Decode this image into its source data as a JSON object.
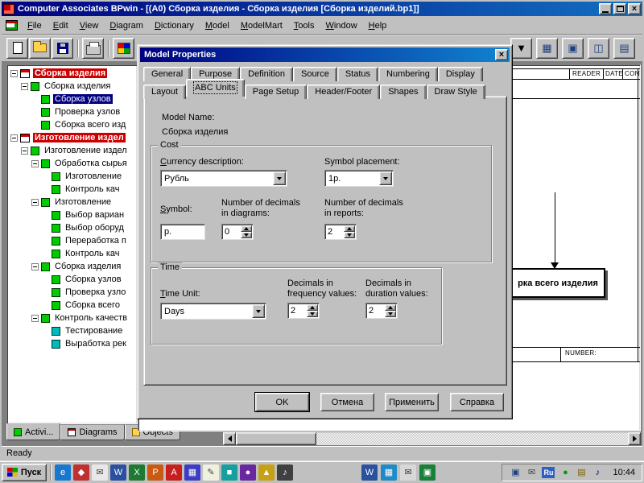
{
  "glyphs": {
    "close": "×"
  },
  "titlebar": {
    "title": "Computer Associates BPwin - [(A0) Сборка изделия - Сборка изделия  [Сборка изделий.bp1]]"
  },
  "menubar": {
    "items": [
      "File",
      "Edit",
      "View",
      "Diagram",
      "Dictionary",
      "Model",
      "ModelMart",
      "Tools",
      "Window",
      "Help"
    ]
  },
  "toolbar": {
    "left_icons": [
      {
        "name": "new-document-icon"
      },
      {
        "name": "open-folder-icon"
      },
      {
        "name": "save-icon"
      },
      {
        "separator": true
      },
      {
        "name": "print-icon"
      },
      {
        "separator": true
      },
      {
        "name": "palette-icon"
      }
    ],
    "right_icons": [
      {
        "name": "dropdown-arrow-icon",
        "glyph": "▼",
        "color": "#000000"
      },
      {
        "name": "tool-grid-icon",
        "glyph": "▦",
        "color": "#204080"
      },
      {
        "name": "tool-box-icon",
        "glyph": "▣",
        "color": "#204080"
      },
      {
        "name": "tool-split-icon",
        "glyph": "◫",
        "color": "#204080"
      },
      {
        "name": "tool-rows-icon",
        "glyph": "▤",
        "color": "#204080"
      }
    ]
  },
  "explorer": {
    "items": [
      {
        "label": "Сборка изделия",
        "level": 0,
        "type": "model",
        "expand": true
      },
      {
        "label": "Сборка изделия",
        "level": 1,
        "type": "activity",
        "expand": true
      },
      {
        "label": "Сборка узлов",
        "level": 2,
        "type": "activity",
        "selected": true
      },
      {
        "label": "Проверка узлов",
        "level": 2,
        "type": "activity"
      },
      {
        "label": "Сборка всего изд",
        "level": 2,
        "type": "activity"
      },
      {
        "label": "Изготовление издел",
        "level": 0,
        "type": "model",
        "expand": true
      },
      {
        "label": "Изготовление издел",
        "level": 1,
        "type": "activity",
        "expand": true
      },
      {
        "label": "Обработка сырья",
        "level": 2,
        "type": "activity",
        "expand": true
      },
      {
        "label": "Изготовление",
        "level": 3,
        "type": "activity"
      },
      {
        "label": "Контроль кач",
        "level": 3,
        "type": "activity"
      },
      {
        "label": "Изготовление",
        "level": 2,
        "type": "activity",
        "expand": true
      },
      {
        "label": "Выбор вариан",
        "level": 3,
        "type": "activity"
      },
      {
        "label": "Выбор оборуд",
        "level": 3,
        "type": "activity"
      },
      {
        "label": "Переработка п",
        "level": 3,
        "type": "activity"
      },
      {
        "label": "Контроль кач",
        "level": 3,
        "type": "activity"
      },
      {
        "label": "Сборка изделия",
        "level": 2,
        "type": "activity",
        "expand": true
      },
      {
        "label": "Сборка узлов",
        "level": 3,
        "type": "activity"
      },
      {
        "label": "Проверка узло",
        "level": 3,
        "type": "activity"
      },
      {
        "label": "Сборка всего",
        "level": 3,
        "type": "activity"
      },
      {
        "label": "Контроль качеств",
        "level": 2,
        "type": "activity",
        "expand": true
      },
      {
        "label": "Тестирование",
        "level": 3,
        "type": "uow"
      },
      {
        "label": "Выработка рек",
        "level": 3,
        "type": "uow"
      }
    ],
    "tabs": [
      {
        "label": "Activi...",
        "icon": "activities-icon",
        "active": true
      },
      {
        "label": "Diagrams",
        "icon": "diagrams-icon"
      },
      {
        "label": "Objects",
        "icon": "objects-icon"
      }
    ]
  },
  "dialog": {
    "title": "Model Properties",
    "tabs_row1": [
      "General",
      "Purpose",
      "Definition",
      "Source",
      "Status",
      "Numbering",
      "Display"
    ],
    "tabs_row2": [
      "Layout",
      "ABC Units",
      "Page Setup",
      "Header/Footer",
      "Shapes",
      "Draw Style"
    ],
    "active_tab": "ABC Units",
    "model_name_label": "Model Name:",
    "model_name": "Сборка изделия",
    "cost": {
      "title": "Cost",
      "currency_label": "Currency description:",
      "currency_value": "Рубль",
      "placement_label": "Symbol placement:",
      "placement_value": "1р.",
      "symbol_label": "Symbol:",
      "symbol_value": "р.",
      "decimals_diagrams_label": "Number of decimals in diagrams:",
      "decimals_diagrams_value": "0",
      "decimals_reports_label": "Number of decimals in reports:",
      "decimals_reports_value": "2"
    },
    "time": {
      "title": "Time",
      "unit_label": "Time Unit:",
      "unit_value": "Days",
      "freq_label": "Decimals in frequency values:",
      "freq_value": "2",
      "dur_label": "Decimals in duration values:",
      "dur_value": "2"
    },
    "buttons": [
      "OK",
      "Отмена",
      "Применить",
      "Справка"
    ]
  },
  "diagram": {
    "header_labels": [
      "READER",
      "DATE",
      "CONT"
    ],
    "box_label": "рка всего изделия",
    "number_label": "NUMBER:"
  },
  "statusbar": {
    "text": "Ready"
  },
  "taskbar": {
    "start_label": "Пуск",
    "quicklaunch": [
      {
        "name": "ie-icon",
        "glyph": "e",
        "bg": "#1878d0",
        "fg": "#ffffff"
      },
      {
        "name": "app-icon-2",
        "glyph": "◆",
        "bg": "#c03030",
        "fg": "#ffffff"
      },
      {
        "name": "mail-icon",
        "glyph": "✉",
        "bg": "#e8e8e8",
        "fg": "#404040"
      },
      {
        "name": "word-icon",
        "glyph": "W",
        "bg": "#2a50a0",
        "fg": "#ffffff"
      },
      {
        "name": "excel-icon",
        "glyph": "X",
        "bg": "#1e7a32",
        "fg": "#ffffff"
      },
      {
        "name": "powerpoint-icon",
        "glyph": "P",
        "bg": "#c85a14",
        "fg": "#ffffff"
      },
      {
        "name": "acrobat-icon",
        "glyph": "A",
        "bg": "#c81e1e",
        "fg": "#ffffff"
      },
      {
        "name": "app-icon-8",
        "glyph": "▦",
        "bg": "#3c3cc8",
        "fg": "#ffffff"
      },
      {
        "name": "notepad-icon",
        "glyph": "✎",
        "bg": "#f0f0e0",
        "fg": "#404040"
      },
      {
        "name": "app-icon-10",
        "glyph": "■",
        "bg": "#14a0a0",
        "fg": "#ffffff"
      },
      {
        "name": "app-icon-11",
        "glyph": "●",
        "bg": "#6a28a0",
        "fg": "#ffffff"
      },
      {
        "name": "app-icon-12",
        "glyph": "▲",
        "bg": "#c8a014",
        "fg": "#ffffff"
      },
      {
        "name": "app-icon-13",
        "glyph": "♪",
        "bg": "#404040",
        "fg": "#ffffff"
      }
    ],
    "mid_icons": [
      {
        "name": "word-window-icon",
        "glyph": "W",
        "bg": "#2a50a0",
        "fg": "#ffffff"
      },
      {
        "name": "app-icon-15",
        "glyph": "▦",
        "bg": "#1e8ac8",
        "fg": "#ffffff"
      },
      {
        "name": "app-icon-16",
        "glyph": "✉",
        "bg": "#d8d8d8",
        "fg": "#333333"
      },
      {
        "name": "app-icon-17",
        "glyph": "▣",
        "bg": "#188038",
        "fg": "#ffffff"
      }
    ],
    "tray_icons_left": [
      {
        "name": "tray-icon-1",
        "glyph": "▣",
        "fg": "#204080"
      },
      {
        "name": "tray-icon-2",
        "glyph": "✉",
        "fg": "#404040"
      }
    ],
    "language_indicator": "Ru",
    "tray_icons_right": [
      {
        "name": "tray-icon-3",
        "glyph": "●",
        "fg": "#00a000"
      },
      {
        "name": "tray-icon-4",
        "glyph": "▤",
        "fg": "#806000"
      },
      {
        "name": "tray-icon-5",
        "glyph": "♪",
        "fg": "#000080"
      }
    ],
    "clock": "10:44"
  }
}
